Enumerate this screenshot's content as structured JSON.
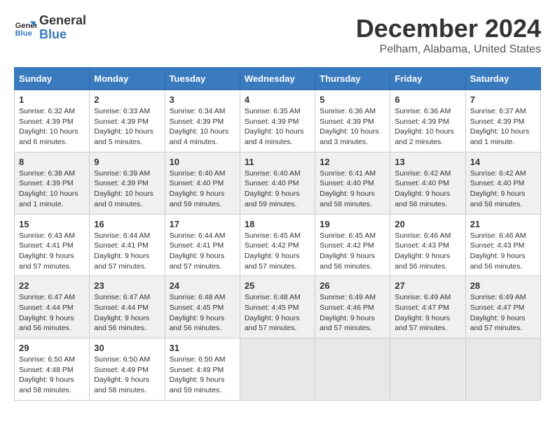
{
  "logo": {
    "line1": "General",
    "line2": "Blue"
  },
  "title": "December 2024",
  "subtitle": "Pelham, Alabama, United States",
  "days_of_week": [
    "Sunday",
    "Monday",
    "Tuesday",
    "Wednesday",
    "Thursday",
    "Friday",
    "Saturday"
  ],
  "weeks": [
    [
      {
        "day": "1",
        "sunrise": "6:32 AM",
        "sunset": "4:39 PM",
        "daylight": "10 hours and 6 minutes."
      },
      {
        "day": "2",
        "sunrise": "6:33 AM",
        "sunset": "4:39 PM",
        "daylight": "10 hours and 5 minutes."
      },
      {
        "day": "3",
        "sunrise": "6:34 AM",
        "sunset": "4:39 PM",
        "daylight": "10 hours and 4 minutes."
      },
      {
        "day": "4",
        "sunrise": "6:35 AM",
        "sunset": "4:39 PM",
        "daylight": "10 hours and 4 minutes."
      },
      {
        "day": "5",
        "sunrise": "6:36 AM",
        "sunset": "4:39 PM",
        "daylight": "10 hours and 3 minutes."
      },
      {
        "day": "6",
        "sunrise": "6:36 AM",
        "sunset": "4:39 PM",
        "daylight": "10 hours and 2 minutes."
      },
      {
        "day": "7",
        "sunrise": "6:37 AM",
        "sunset": "4:39 PM",
        "daylight": "10 hours and 1 minute."
      }
    ],
    [
      {
        "day": "8",
        "sunrise": "6:38 AM",
        "sunset": "4:39 PM",
        "daylight": "10 hours and 1 minute."
      },
      {
        "day": "9",
        "sunrise": "6:39 AM",
        "sunset": "4:39 PM",
        "daylight": "10 hours and 0 minutes."
      },
      {
        "day": "10",
        "sunrise": "6:40 AM",
        "sunset": "4:40 PM",
        "daylight": "9 hours and 59 minutes."
      },
      {
        "day": "11",
        "sunrise": "6:40 AM",
        "sunset": "4:40 PM",
        "daylight": "9 hours and 59 minutes."
      },
      {
        "day": "12",
        "sunrise": "6:41 AM",
        "sunset": "4:40 PM",
        "daylight": "9 hours and 58 minutes."
      },
      {
        "day": "13",
        "sunrise": "6:42 AM",
        "sunset": "4:40 PM",
        "daylight": "9 hours and 58 minutes."
      },
      {
        "day": "14",
        "sunrise": "6:42 AM",
        "sunset": "4:40 PM",
        "daylight": "9 hours and 58 minutes."
      }
    ],
    [
      {
        "day": "15",
        "sunrise": "6:43 AM",
        "sunset": "4:41 PM",
        "daylight": "9 hours and 57 minutes."
      },
      {
        "day": "16",
        "sunrise": "6:44 AM",
        "sunset": "4:41 PM",
        "daylight": "9 hours and 57 minutes."
      },
      {
        "day": "17",
        "sunrise": "6:44 AM",
        "sunset": "4:41 PM",
        "daylight": "9 hours and 57 minutes."
      },
      {
        "day": "18",
        "sunrise": "6:45 AM",
        "sunset": "4:42 PM",
        "daylight": "9 hours and 57 minutes."
      },
      {
        "day": "19",
        "sunrise": "6:45 AM",
        "sunset": "4:42 PM",
        "daylight": "9 hours and 56 minutes."
      },
      {
        "day": "20",
        "sunrise": "6:46 AM",
        "sunset": "4:43 PM",
        "daylight": "9 hours and 56 minutes."
      },
      {
        "day": "21",
        "sunrise": "6:46 AM",
        "sunset": "4:43 PM",
        "daylight": "9 hours and 56 minutes."
      }
    ],
    [
      {
        "day": "22",
        "sunrise": "6:47 AM",
        "sunset": "4:44 PM",
        "daylight": "9 hours and 56 minutes."
      },
      {
        "day": "23",
        "sunrise": "6:47 AM",
        "sunset": "4:44 PM",
        "daylight": "9 hours and 56 minutes."
      },
      {
        "day": "24",
        "sunrise": "6:48 AM",
        "sunset": "4:45 PM",
        "daylight": "9 hours and 56 minutes."
      },
      {
        "day": "25",
        "sunrise": "6:48 AM",
        "sunset": "4:45 PM",
        "daylight": "9 hours and 57 minutes."
      },
      {
        "day": "26",
        "sunrise": "6:49 AM",
        "sunset": "4:46 PM",
        "daylight": "9 hours and 57 minutes."
      },
      {
        "day": "27",
        "sunrise": "6:49 AM",
        "sunset": "4:47 PM",
        "daylight": "9 hours and 57 minutes."
      },
      {
        "day": "28",
        "sunrise": "6:49 AM",
        "sunset": "4:47 PM",
        "daylight": "9 hours and 57 minutes."
      }
    ],
    [
      {
        "day": "29",
        "sunrise": "6:50 AM",
        "sunset": "4:48 PM",
        "daylight": "9 hours and 58 minutes."
      },
      {
        "day": "30",
        "sunrise": "6:50 AM",
        "sunset": "4:49 PM",
        "daylight": "9 hours and 58 minutes."
      },
      {
        "day": "31",
        "sunrise": "6:50 AM",
        "sunset": "4:49 PM",
        "daylight": "9 hours and 59 minutes."
      },
      null,
      null,
      null,
      null
    ]
  ]
}
